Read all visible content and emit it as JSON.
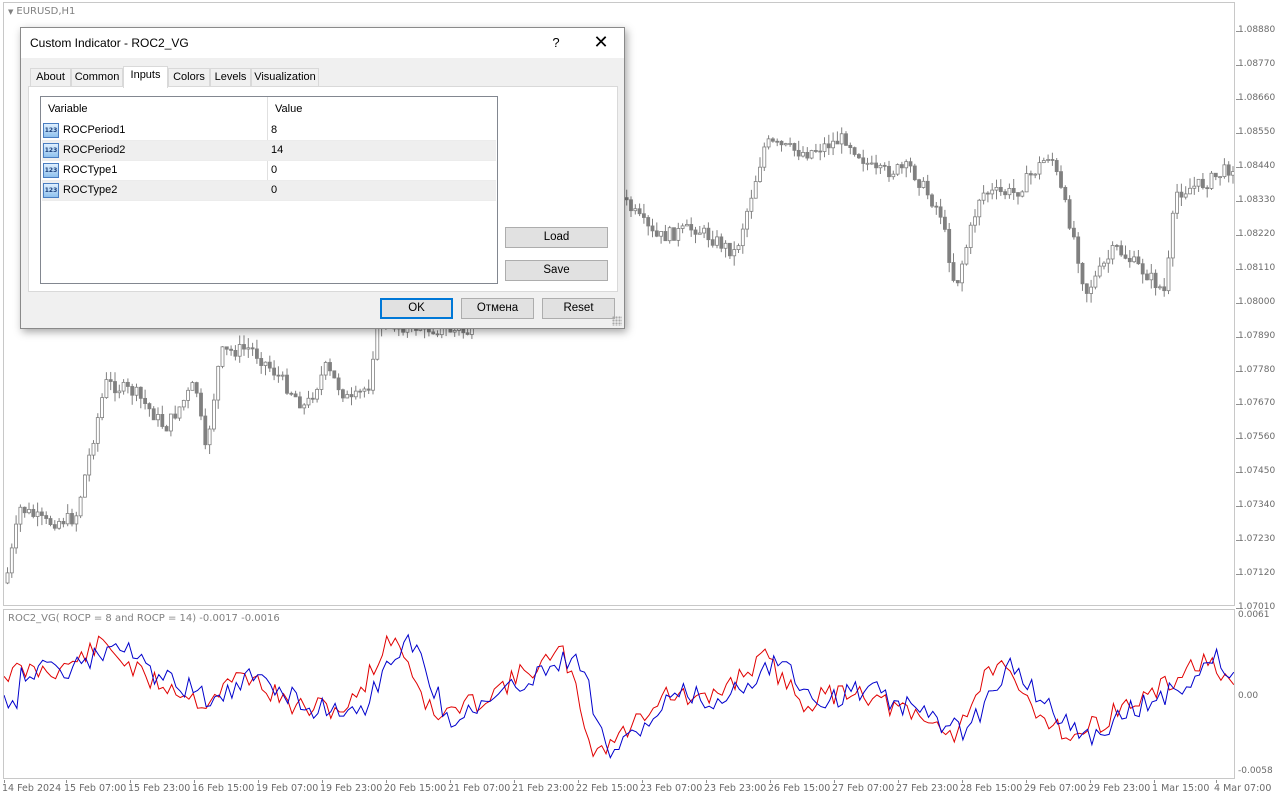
{
  "chart": {
    "symbol_title": "EURUSD,H1",
    "indicator_title": "ROC2_VG( ROCP = 8 and ROCP = 14) -0.0017 -0.0016",
    "price_labels": [
      "1.08880",
      "1.08770",
      "1.08660",
      "1.08550",
      "1.08440",
      "1.08330",
      "1.08220",
      "1.08110",
      "1.08000",
      "1.07890",
      "1.07780",
      "1.07670",
      "1.07560",
      "1.07450",
      "1.07340",
      "1.07230",
      "1.07120",
      "1.07010"
    ],
    "indicator_labels": [
      "0.0061",
      "0.00",
      "-0.0058"
    ],
    "time_labels": [
      "14 Feb 2024",
      "15 Feb 07:00",
      "15 Feb 23:00",
      "16 Feb 15:00",
      "19 Feb 07:00",
      "19 Feb 23:00",
      "20 Feb 15:00",
      "21 Feb 07:00",
      "21 Feb 23:00",
      "22 Feb 15:00",
      "23 Feb 07:00",
      "23 Feb 23:00",
      "26 Feb 15:00",
      "27 Feb 07:00",
      "27 Feb 23:00",
      "28 Feb 15:00",
      "29 Feb 07:00",
      "29 Feb 23:00",
      "1 Mar 15:00",
      "4 Mar 07:00"
    ],
    "colors": {
      "candle": "#808080",
      "roc1": "#e00000",
      "roc2": "#0000cc"
    }
  },
  "dialog": {
    "title": "Custom Indicator - ROC2_VG",
    "help_glyph": "?",
    "close_glyph": "✕",
    "tabs": [
      {
        "label": "About"
      },
      {
        "label": "Common"
      },
      {
        "label": "Inputs"
      },
      {
        "label": "Colors"
      },
      {
        "label": "Levels"
      },
      {
        "label": "Visualization"
      }
    ],
    "active_tab": "Inputs",
    "table": {
      "col_variable": "Variable",
      "col_value": "Value",
      "icon_text": "123",
      "rows": [
        {
          "name": "ROCPeriod1",
          "value": "8"
        },
        {
          "name": "ROCPeriod2",
          "value": "14"
        },
        {
          "name": "ROCType1",
          "value": "0"
        },
        {
          "name": "ROCType2",
          "value": "0"
        }
      ]
    },
    "buttons": {
      "load": "Load",
      "save": "Save",
      "ok": "OK",
      "cancel": "Отмена",
      "reset": "Reset"
    }
  }
}
